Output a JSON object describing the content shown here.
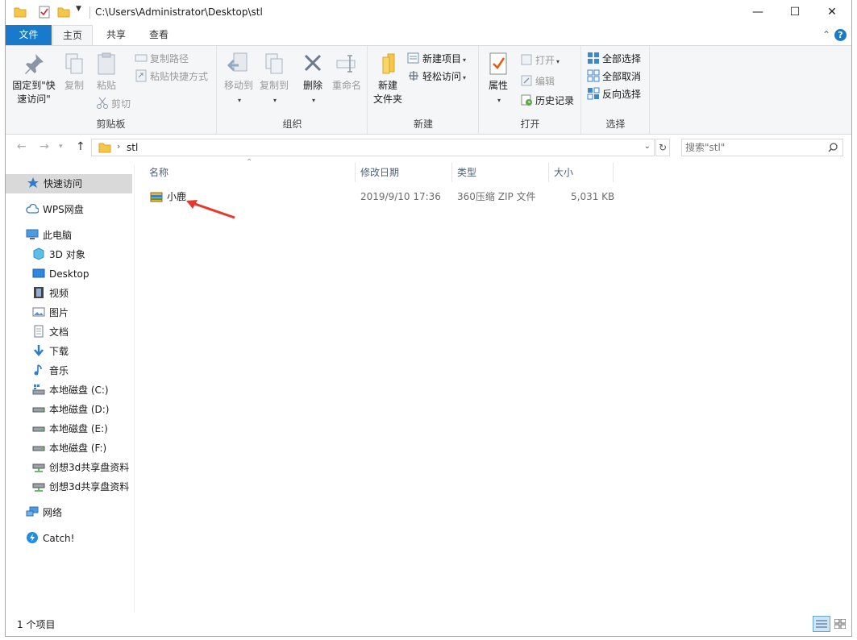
{
  "window": {
    "path": "C:\\Users\\Administrator\\Desktop\\stl",
    "minimize_icon": "minimize-icon",
    "maximize_icon": "maximize-icon",
    "close_icon": "close-icon"
  },
  "tabs": {
    "file": "文件",
    "home": "主页",
    "share": "共享",
    "view": "查看"
  },
  "ribbon": {
    "clipboard": {
      "label": "剪贴板",
      "pin_line1": "固定到\"快",
      "pin_line2": "速访问\"",
      "copy": "复制",
      "paste": "粘贴",
      "copy_path": "复制路径",
      "paste_shortcut": "粘贴快捷方式",
      "cut": "剪切"
    },
    "organize": {
      "label": "组织",
      "move_to": "移动到",
      "copy_to": "复制到",
      "delete": "删除",
      "rename": "重命名"
    },
    "new": {
      "label": "新建",
      "new_folder_line1": "新建",
      "new_folder_line2": "文件夹",
      "new_item": "新建项目",
      "easy_access": "轻松访问"
    },
    "open": {
      "label": "打开",
      "properties": "属性",
      "open": "打开",
      "edit": "编辑",
      "history": "历史记录"
    },
    "select": {
      "label": "选择",
      "select_all": "全部选择",
      "select_none": "全部取消",
      "invert": "反向选择"
    }
  },
  "address": {
    "folder": "stl",
    "search_placeholder": "搜索\"stl\""
  },
  "nav": {
    "quick_access": "快速访问",
    "wps": "WPS网盘",
    "this_pc": "此电脑",
    "objects3d": "3D 对象",
    "desktop": "Desktop",
    "videos": "视频",
    "pictures": "图片",
    "documents": "文档",
    "downloads": "下载",
    "music": "音乐",
    "drive_c": "本地磁盘 (C:)",
    "drive_d": "本地磁盘 (D:)",
    "drive_e": "本地磁盘 (E:)",
    "drive_f": "本地磁盘 (F:)",
    "share1": "创想3d共享盘资料",
    "share2": "创想3d共享盘资料",
    "network": "网络",
    "catch": "Catch!"
  },
  "columns": {
    "name": "名称",
    "modified": "修改日期",
    "type": "类型",
    "size": "大小"
  },
  "files": [
    {
      "name": "小鹿",
      "modified": "2019/9/10 17:36",
      "type": "360压缩 ZIP 文件",
      "size": "5,031 KB"
    }
  ],
  "status": {
    "count": "1 个项目"
  },
  "colors": {
    "accent": "#1979ca",
    "arrow": "#e8372c",
    "folder": "#f4c64a"
  }
}
